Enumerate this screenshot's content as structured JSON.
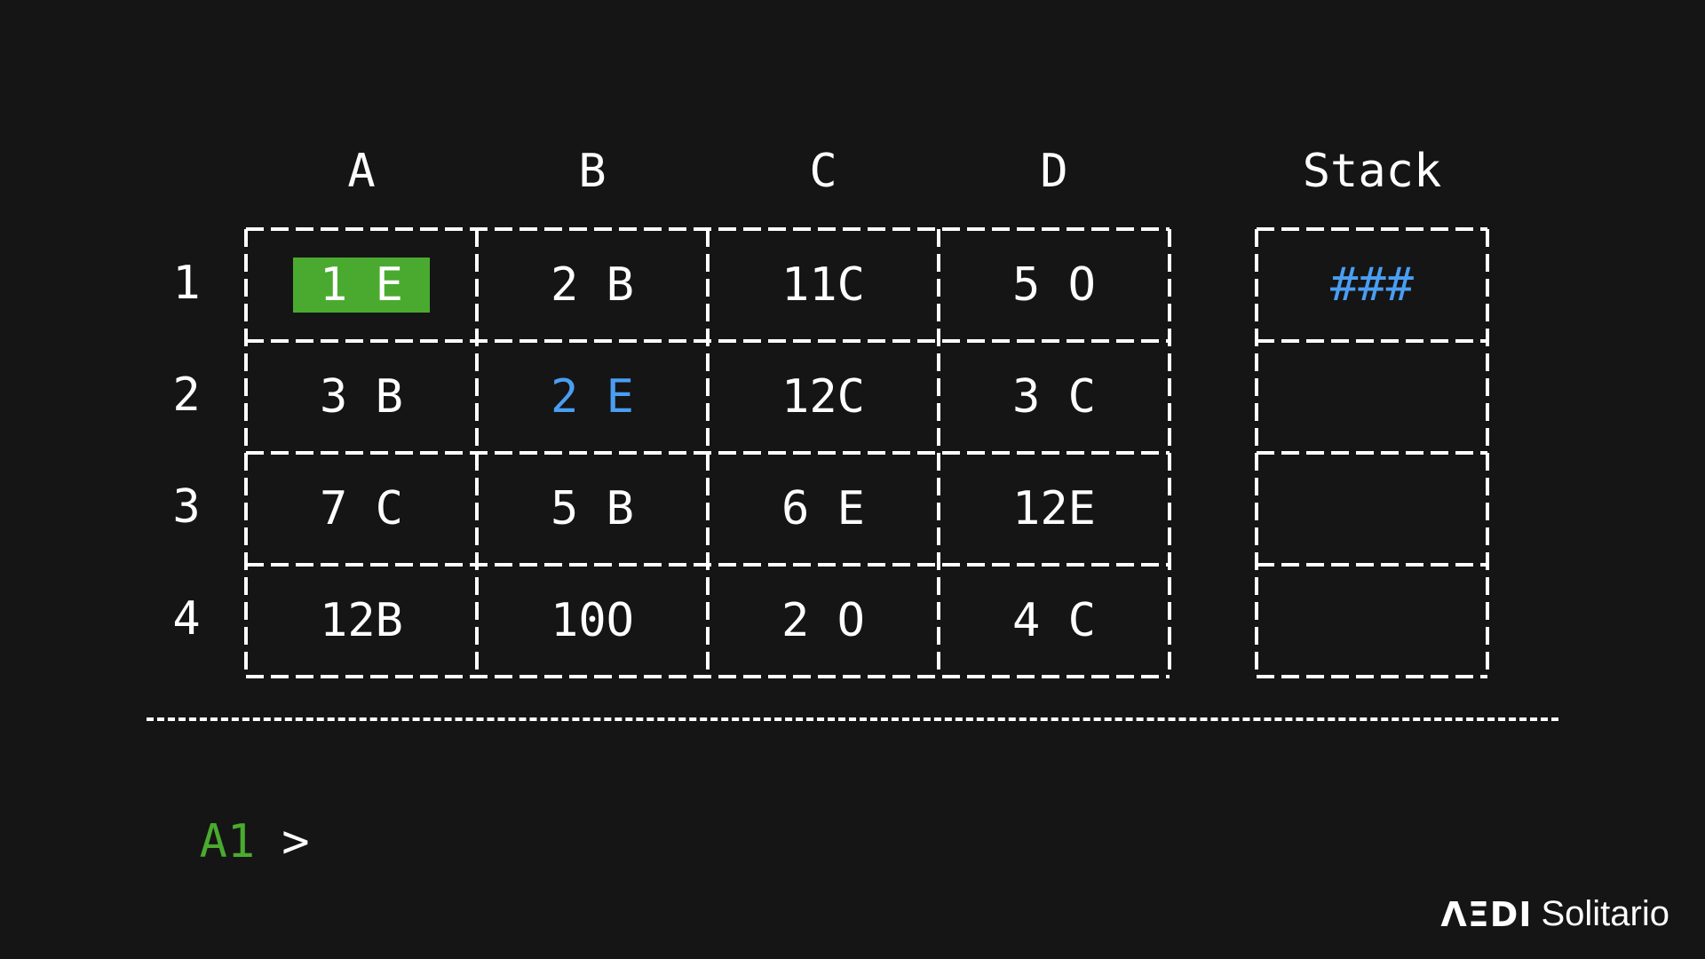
{
  "board": {
    "columns": [
      "A",
      "B",
      "C",
      "D"
    ],
    "rows": [
      "1",
      "2",
      "3",
      "4"
    ],
    "cells": [
      [
        "1 E",
        "2 B",
        "11C",
        "5 O"
      ],
      [
        "3 B",
        "2 E",
        "12C",
        "3 C"
      ],
      [
        "7 C",
        "5 B",
        "6 E",
        "12E"
      ],
      [
        "12B",
        "10O",
        "2 O",
        "4 C"
      ]
    ],
    "selected_cell": "A1",
    "highlighted_cell": "B2"
  },
  "stack": {
    "title": "Stack",
    "cells": [
      "###",
      "",
      "",
      ""
    ]
  },
  "prompt": {
    "location": "A1",
    "symbol": ">"
  },
  "branding": {
    "logo_text": "ΛΞDI",
    "app_name": "Solitario"
  },
  "colors": {
    "background": "#151515",
    "selected": "#4aaa2f",
    "highlight": "#4a9ef2",
    "text": "#ffffff"
  }
}
